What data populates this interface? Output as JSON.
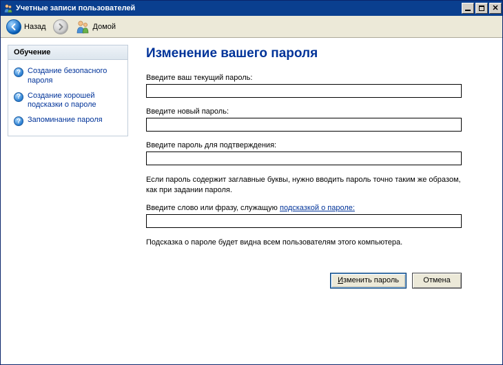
{
  "window": {
    "title": "Учетные записи пользователей"
  },
  "toolbar": {
    "back_label": "Назад",
    "home_label": "Домой"
  },
  "sidebar": {
    "header": "Обучение",
    "items": [
      {
        "label": "Создание безопасного пароля"
      },
      {
        "label": "Создание хорошей подсказки о пароле"
      },
      {
        "label": "Запоминание пароля"
      }
    ]
  },
  "main": {
    "heading": "Изменение вашего пароля",
    "current_pw_label": "Введите ваш текущий пароль:",
    "new_pw_label": "Введите новый пароль:",
    "confirm_pw_label": "Введите пароль для подтверждения:",
    "case_note": "Если пароль содержит заглавные буквы, нужно вводить пароль точно таким же образом, как при задании пароля.",
    "hint_label_prefix": "Введите слово или фразу, служащую ",
    "hint_link_text": "подсказкой о пароле:",
    "hint_note": "Подсказка о пароле будет видна всем пользователям этого компьютера.",
    "submit_full": "Изменить пароль",
    "submit_rest": "зменить пароль",
    "cancel_label": "Отмена",
    "current_pw_value": "",
    "new_pw_value": "",
    "confirm_pw_value": "",
    "hint_value": ""
  }
}
